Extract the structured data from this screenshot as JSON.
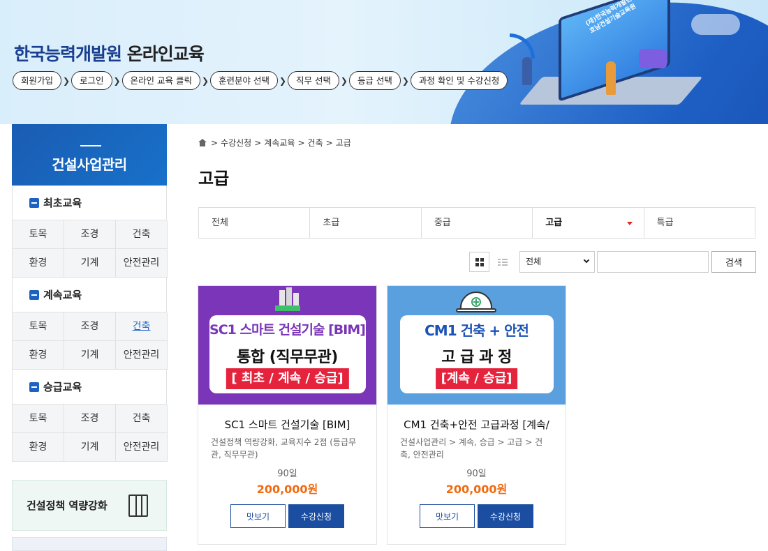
{
  "header": {
    "logo_main": "한국능력개발원",
    "logo_sub": " 온라인교육",
    "steps": [
      "회원가입",
      "로그인",
      "온라인 교육 클릭",
      "훈련분야 선택",
      "직무 선택",
      "등급 선택",
      "과정 확인 및 수강신청"
    ],
    "laptop_label": "(재)한국능력개발원 호남건설기술교육원"
  },
  "sidebar": {
    "title": "건설사업관리",
    "groups": [
      {
        "label": "최초교육",
        "items": [
          "토목",
          "조경",
          "건축",
          "환경",
          "기계",
          "안전관리"
        ]
      },
      {
        "label": "계속교육",
        "items": [
          "토목",
          "조경",
          "건축",
          "환경",
          "기계",
          "안전관리"
        ],
        "active_index": 2
      },
      {
        "label": "승급교육",
        "items": [
          "토목",
          "조경",
          "건축",
          "환경",
          "기계",
          "안전관리"
        ]
      }
    ],
    "banner": "건설정책 역량강화"
  },
  "breadcrumb": [
    "수강신청",
    "계속교육",
    "건축",
    "고급"
  ],
  "page_title": "고급",
  "tabs": [
    {
      "label": "전체"
    },
    {
      "label": "초급"
    },
    {
      "label": "중급"
    },
    {
      "label": "고급",
      "active": true
    },
    {
      "label": "특급"
    }
  ],
  "toolbar": {
    "select_value": "전체",
    "search_placeholder": "",
    "search_label": "검색"
  },
  "colors": {
    "primary": "#1b4da0",
    "accent": "#1b62c3",
    "price": "#f06a10",
    "tag": "#e5233d"
  },
  "cards": [
    {
      "thumb_line1": "SC1 스마트 건설기술 [BIM]",
      "thumb_line2": "통합 (직무무관)",
      "thumb_tag": "[ 최초 / 계속 / 승급]",
      "title": "SC1 스마트 건설기술 [BIM]",
      "desc": "건설정책 역량강화, 교육지수 2점 (등급무관, 직무무관)",
      "days": "90일",
      "price": "200,000원",
      "preview_label": "맛보기",
      "apply_label": "수강신청"
    },
    {
      "thumb_line1": "CM1 건축 + 안전",
      "thumb_line2": "고 급 과 정",
      "thumb_tag": "[계속 / 승급]",
      "title": "CM1 건축+안전 고급과정 [계속/",
      "desc": "건설사업관리 > 계속, 승급 > 고급 > 건축, 안전관리",
      "days": "90일",
      "price": "200,000원",
      "preview_label": "맛보기",
      "apply_label": "수강신청"
    }
  ]
}
